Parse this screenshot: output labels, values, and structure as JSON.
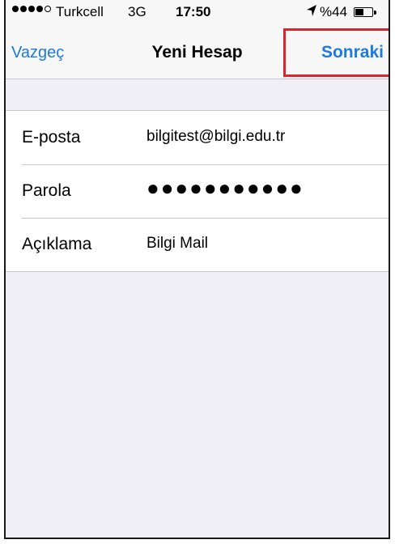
{
  "status_bar": {
    "carrier": "Turkcell",
    "network": "3G",
    "time": "17:50",
    "battery_percent": "%44",
    "battery_level": 0.44,
    "signal_bars_filled": 4,
    "signal_bars_total": 5
  },
  "nav": {
    "cancel_label": "Vazgeç",
    "title": "Yeni Hesap",
    "next_label": "Sonraki",
    "highlight_color": "#d9252c",
    "accent_color": "#1f7ae0"
  },
  "form": {
    "email": {
      "label": "E-posta",
      "value": "bilgitest@bilgi.edu.tr"
    },
    "password": {
      "label": "Parola",
      "value": "●●●●●●●●●●●"
    },
    "description": {
      "label": "Açıklama",
      "value": "Bilgi Mail"
    }
  }
}
